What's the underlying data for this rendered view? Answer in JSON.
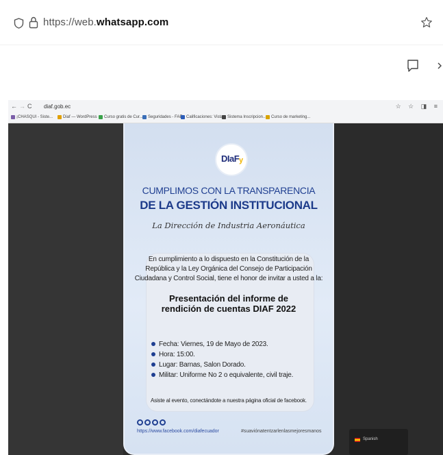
{
  "browser": {
    "url_prefix": "https://web.",
    "url_domain": "whatsapp.com"
  },
  "inner_browser": {
    "nav_back": "←",
    "nav_forward": "→",
    "nav_reload": "C",
    "url": "diaf.gob.ec",
    "tools": "☆ ☆ ◨ ≡",
    "bookmarks": [
      "¡CHASQUI - Siste...",
      "Diaf — WordPress",
      "Curso gratis de Cur...",
      "Seguridades - FAE",
      "Calificaciones: Vista",
      "Sistema Inscripcion...",
      "Curso de marketing..."
    ]
  },
  "poster": {
    "logo_text": "DIaF",
    "logo_accent": "y",
    "title_line1": "CUMPLIMOS CON LA TRANSPARENCIA",
    "title_line2": "DE LA GESTIÓN INSTITUCIONAL",
    "subtitle": "La Dirección de Industria Aeronáutica",
    "invitation_line1": "En cumplimiento a lo dispuesto en la Constitución de la",
    "invitation_line2": "República y la Ley Orgánica del Consejo de Participación",
    "invitation_line3": "Ciudadana y Control Social, tiene el honor de invitar a usted a la:",
    "presentation_line1": "Presentación del informe de",
    "presentation_line2": "rendición de cuentas DIAF 2022",
    "details": [
      "Fecha: Viernes, 19 de Mayo de 2023.",
      "Hora: 15:00.",
      "Lugar: Barnas, Salon Dorado.",
      "Militar: Uniforme No 2 o equivalente, civil traje."
    ],
    "closing": "Asiste al evento, conectándote a nuestra página oficial de facebook.",
    "facebook_url": "https://www.facebook.com/diafecuador",
    "hashtag": "#suaviónatentzarlenlasmejoresmanos"
  },
  "language_chip": {
    "label": "Spanish"
  },
  "colors": {
    "poster_blue": "#1f3f91",
    "logo_yellow": "#f2b705"
  }
}
